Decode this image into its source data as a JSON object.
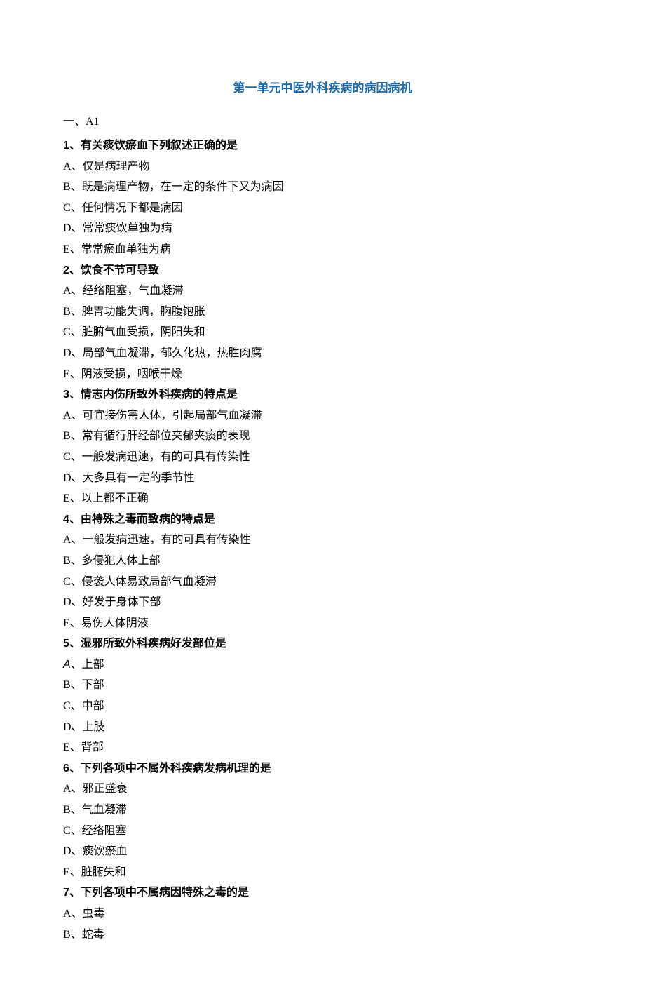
{
  "title": "第一单元中医外科疾病的病因病机",
  "section_label": "一、A1",
  "questions": [
    {
      "num": "1",
      "stem": "有关痰饮瘀血下列叙述正确的是",
      "options": [
        "A、仅是病理产物",
        "B、既是病理产物，在一定的条件下又为病因",
        "C、任何情况下都是病因",
        "D、常常痰饮单独为病",
        "E、常常瘀血单独为病"
      ]
    },
    {
      "num": "2",
      "stem": "饮食不节可导致",
      "options": [
        "A、经络阻塞，气血凝滞",
        "B、脾胃功能失调，胸腹饱胀",
        "C、脏腑气血受损，阴阳失和",
        "D、局部气血凝滞，郁久化热，热胜肉腐",
        "E、阴液受损，咽喉干燥"
      ]
    },
    {
      "num": "3",
      "stem": "情志内伤所致外科疾病的特点是",
      "options": [
        "A、可宜接伤害人体，引起局部气血凝滞",
        "B、常有循行肝经部位夹郁夹痰的表现",
        "C、一般发病迅速，有的可具有传染性",
        "D、大多具有一定的季节性",
        "E、以上都不正确"
      ]
    },
    {
      "num": "4",
      "stem": "由特殊之毒而致病的特点是",
      "options": [
        "A、一般发病迅速，有的可具有传染性",
        "B、多侵犯人体上部",
        "C、侵袭人体易致局部气血凝滞",
        "D、好发于身体下部",
        "E、易伤人体阴液"
      ]
    },
    {
      "num": "5",
      "stem": "湿邪所致外科疾病好发部位是",
      "first_option_italic": true,
      "options": [
        "A、上部",
        "B、下部",
        "C、中部",
        "D、上肢",
        "E、背部"
      ]
    },
    {
      "num": "6",
      "stem": "下列各项中不属外科疾病发病机理的是",
      "options": [
        "A、邪正盛衰",
        "B、气血凝滞",
        "C、经络阻塞",
        "D、痰饮瘀血",
        "E、脏腑失和"
      ]
    },
    {
      "num": "7",
      "stem": "下列各项中不属病因特殊之毒的是",
      "options": [
        "A、虫毒",
        "B、蛇毒"
      ]
    }
  ]
}
